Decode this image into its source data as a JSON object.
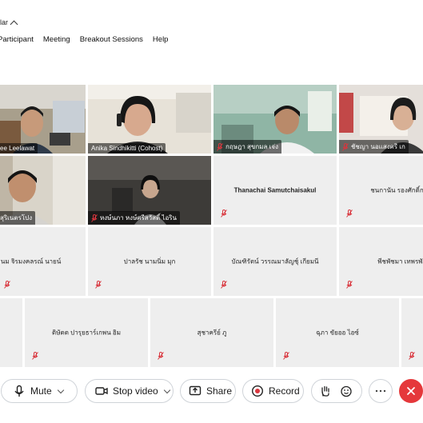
{
  "topbar": {
    "label": "lar"
  },
  "menubar": {
    "items": [
      "Participant",
      "Meeting",
      "Breakout Sessions",
      "Help"
    ]
  },
  "tiles": [
    {
      "name": "ee Leelawat",
      "muted": false
    },
    {
      "name": "Anika Sindhikitti (Cohost)",
      "muted": false
    },
    {
      "name": "กฤษฎา สุขกมล เจ่ง",
      "muted": true
    },
    {
      "name": "ชัชญา นอแสงศรี เก",
      "muted": true
    },
    {
      "name": "สุริเนตรโปง",
      "muted": false
    },
    {
      "name": "หงษ์นภา หงษ์ศรีสวัสดิ์ ไอริน",
      "muted": true
    },
    {
      "name": "Thanachai Samutchaisakul",
      "muted": true
    },
    {
      "name": "ชนกานัน รองศักดิ์กร์",
      "muted": true
    },
    {
      "name": "ธนม จิรมงคลรณ์ นายน์",
      "muted": true
    },
    {
      "name": "ปาลรัช นามนิ่ม มุก",
      "muted": true
    },
    {
      "name": "บัณฑิรัตน์ วรรณมาลัญชุ์ เกียมนี",
      "muted": true
    },
    {
      "name": "พีชพัชมา เทพรพัน",
      "muted": true
    },
    {
      "name": "",
      "muted": false
    },
    {
      "name": "ดิษัตต ปารุยธาร์เกพน อิม",
      "muted": true
    },
    {
      "name": "สุชาครีย์ ภู",
      "muted": true
    },
    {
      "name": "ฉุภา ขัยออ ไอซ์",
      "muted": true
    },
    {
      "name": "",
      "muted": true
    }
  ],
  "toolbar": {
    "mute_label": "Mute",
    "stop_video_label": "Stop video",
    "share_label": "Share",
    "record_label": "Record"
  },
  "colors": {
    "active_speaker_border": "#3b7bd6",
    "muted_mic": "#d9363e",
    "end_call": "#e5383b",
    "record_dot": "#d9363e"
  }
}
